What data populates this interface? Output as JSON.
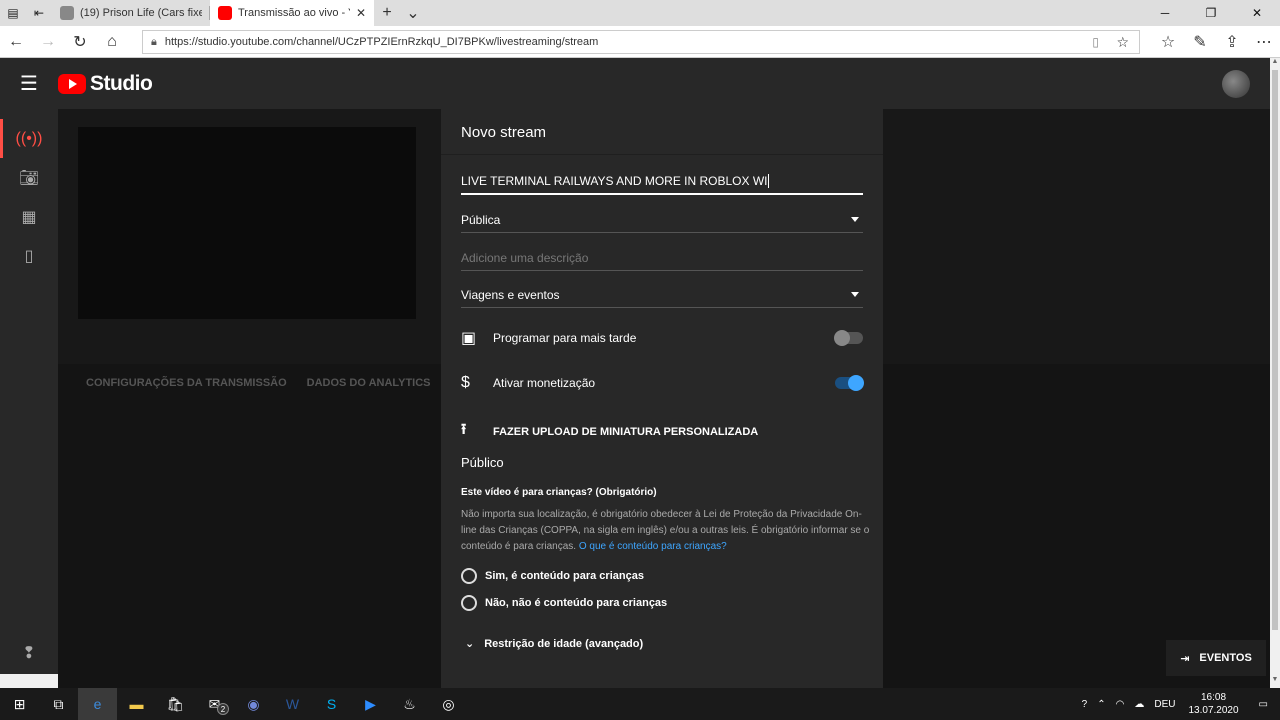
{
  "browser": {
    "tabs": [
      {
        "title": "(19) Prison Life (Cars fixed!)",
        "favicon_color": "#888888"
      },
      {
        "title": "Transmissão ao vivo - Yo",
        "favicon_color": "#ff0000"
      }
    ],
    "url": "https://studio.youtube.com/channel/UCzPTPZIErnRzkqU_DI7BPKw/livestreaming/stream"
  },
  "header": {
    "logo_text": "Studio"
  },
  "main": {
    "tabs": [
      "CONFIGURAÇÕES DA TRANSMISSÃO",
      "DADOS DO ANALYTICS"
    ]
  },
  "modal": {
    "title": "Novo stream",
    "stream_title_value": "LIVE TERMINAL RAILWAYS AND MORE IN ROBLOX WI",
    "visibility_value": "Pública",
    "description_placeholder": "Adicione uma descrição",
    "category_value": "Viagens e eventos",
    "schedule_label": "Programar para mais tarde",
    "schedule_enabled": false,
    "monetization_label": "Ativar monetização",
    "monetization_enabled": true,
    "upload_thumbnail_label": "FAZER UPLOAD DE MINIATURA PERSONALIZADA",
    "audience_title": "Público",
    "kids_question": "Este vídeo é para crianças? (Obrigatório)",
    "kids_description": "Não importa sua localização, é obrigatório obedecer à Lei de Proteção da Privacidade On-line das Crianças (COPPA, na sigla em inglês) e/ou a outras leis. É obrigatório informar se o conteúdo é para crianças.",
    "kids_link": "O que é conteúdo para crianças?",
    "option_yes": "Sim, é conteúdo para crianças",
    "option_no": "Não, não é conteúdo para crianças",
    "age_restriction_label": "Restrição de idade (avançado)",
    "accent_color": "#3ea6ff"
  },
  "events_button": "EVENTOS",
  "taskbar": {
    "mail_badge": "2",
    "language": "DEU",
    "time": "16:08",
    "date": "13.07.2020"
  }
}
